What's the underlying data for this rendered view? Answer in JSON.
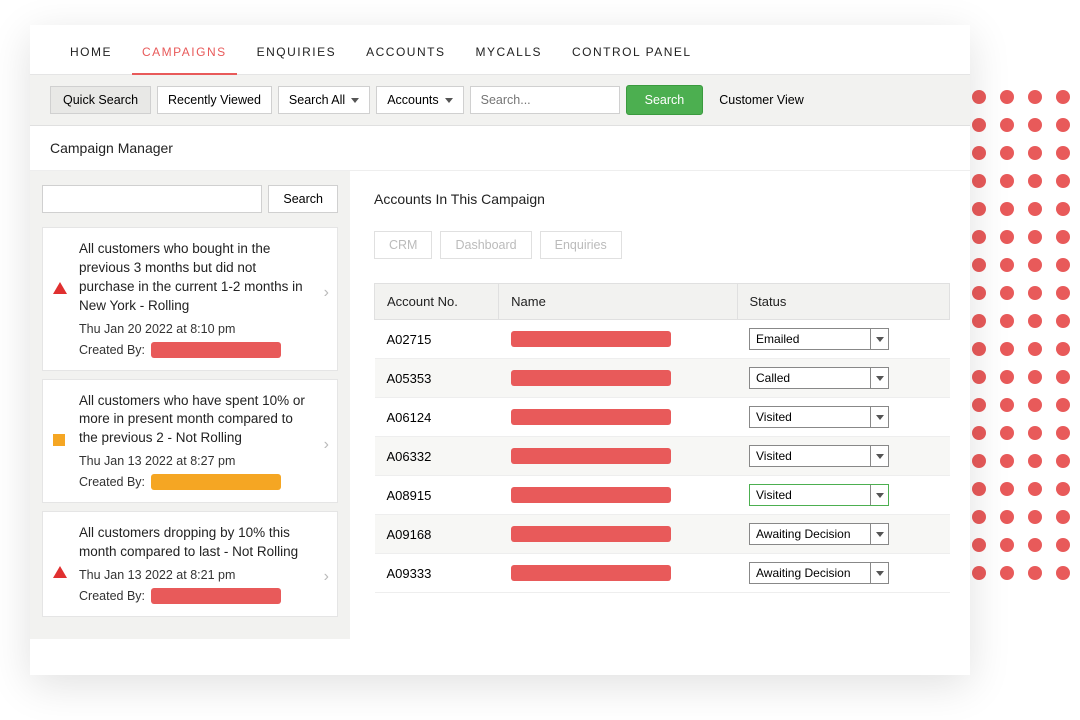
{
  "nav": {
    "items": [
      "HOME",
      "CAMPAIGNS",
      "ENQUIRIES",
      "ACCOUNTS",
      "MYCALLS",
      "CONTROL PANEL"
    ],
    "active_index": 1
  },
  "searchbar": {
    "quick_search": "Quick Search",
    "recently_viewed": "Recently Viewed",
    "search_all": "Search All",
    "accounts": "Accounts",
    "placeholder": "Search...",
    "search_btn": "Search",
    "customer_view": "Customer View"
  },
  "page_title": "Campaign Manager",
  "sidebar": {
    "search_btn": "Search",
    "items": [
      {
        "marker": "tri-red",
        "title": "All customers who bought in the previous 3 months but did not purchase in the current 1-2 months in New York - Rolling",
        "date": "Thu Jan 20 2022 at 8:10 pm",
        "created_by_label": "Created By:",
        "redact": "red"
      },
      {
        "marker": "sq-orange",
        "title": "All customers who have spent 10% or more in present month compared to the previous 2 - Not Rolling",
        "date": "Thu Jan 13 2022 at 8:27 pm",
        "created_by_label": "Created By:",
        "redact": "orange"
      },
      {
        "marker": "tri-red",
        "title": "All customers dropping by 10% this month compared to last - Not Rolling",
        "date": "Thu Jan 13 2022 at 8:21 pm",
        "created_by_label": "Created By:",
        "redact": "red"
      }
    ]
  },
  "main": {
    "title": "Accounts In This Campaign",
    "tabs": [
      "CRM",
      "Dashboard",
      "Enquiries"
    ],
    "table": {
      "headers": [
        "Account No.",
        "Name",
        "Status"
      ],
      "rows": [
        {
          "acct": "A02715",
          "status": "Emailed"
        },
        {
          "acct": "A05353",
          "status": "Called"
        },
        {
          "acct": "A06124",
          "status": "Visited"
        },
        {
          "acct": "A06332",
          "status": "Visited"
        },
        {
          "acct": "A08915",
          "status": "Visited",
          "active": true
        },
        {
          "acct": "A09168",
          "status": "Awaiting Decision"
        },
        {
          "acct": "A09333",
          "status": "Awaiting Decision"
        }
      ]
    }
  }
}
